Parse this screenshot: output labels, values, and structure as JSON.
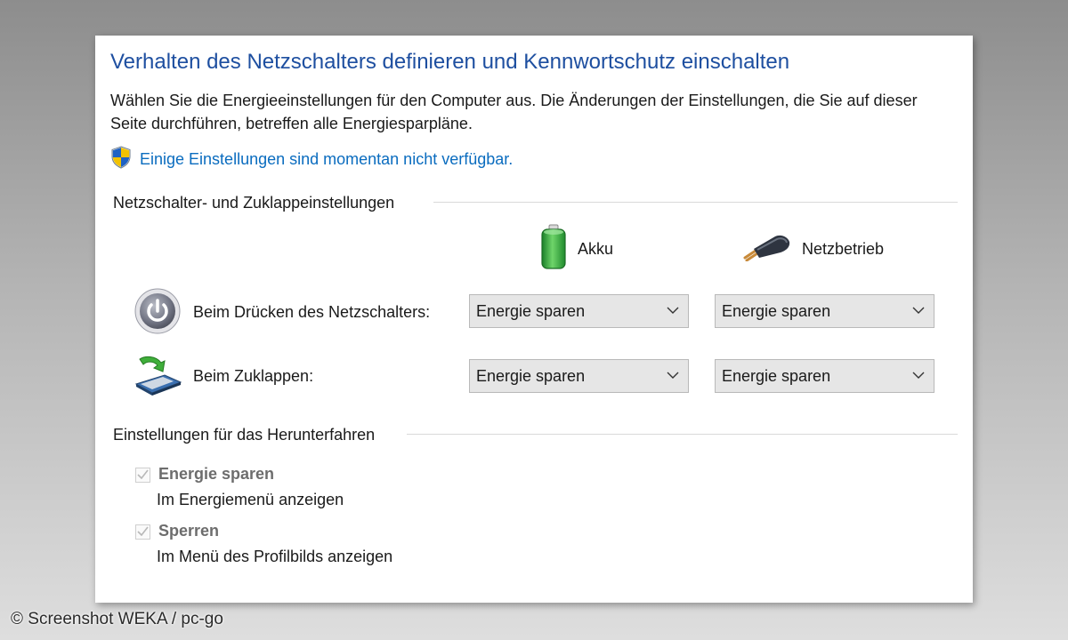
{
  "window": {
    "title": "Verhalten des Netzschalters definieren und Kennwortschutz einschalten",
    "description": "Wählen Sie die Energieeinstellungen für den Computer aus. Die Änderungen der Einstellungen, die Sie auf dieser Seite durchführen, betreffen alle Energiesparpläne.",
    "admin_link": "Einige Einstellungen sind momentan nicht verfügbar."
  },
  "power_section": {
    "title": "Netzschalter- und Zuklappeinstellungen",
    "columns": [
      {
        "label": "Akku",
        "icon": "battery-icon"
      },
      {
        "label": "Netzbetrieb",
        "icon": "power-plug-icon"
      }
    ],
    "rows": [
      {
        "label": "Beim Drücken des Netzschalters:",
        "icon": "power-button-icon",
        "battery_value": "Energie sparen",
        "plugged_value": "Energie sparen"
      },
      {
        "label": "Beim Zuklappen:",
        "icon": "laptop-lid-icon",
        "battery_value": "Energie sparen",
        "plugged_value": "Energie sparen"
      }
    ]
  },
  "shutdown_section": {
    "title": "Einstellungen für das Herunterfahren",
    "options": [
      {
        "label": "Energie sparen",
        "sublabel": "Im Energiemenü anzeigen",
        "checked": true,
        "enabled": false
      },
      {
        "label": "Sperren",
        "sublabel": "Im Menü des Profilbilds anzeigen",
        "checked": true,
        "enabled": false
      }
    ]
  },
  "watermark": "© Screenshot WEKA / pc-go",
  "colors": {
    "title": "#1e4fa0",
    "link": "#0a6cbf",
    "select_bg": "#e6e6e6",
    "battery": "#2ea43a"
  }
}
